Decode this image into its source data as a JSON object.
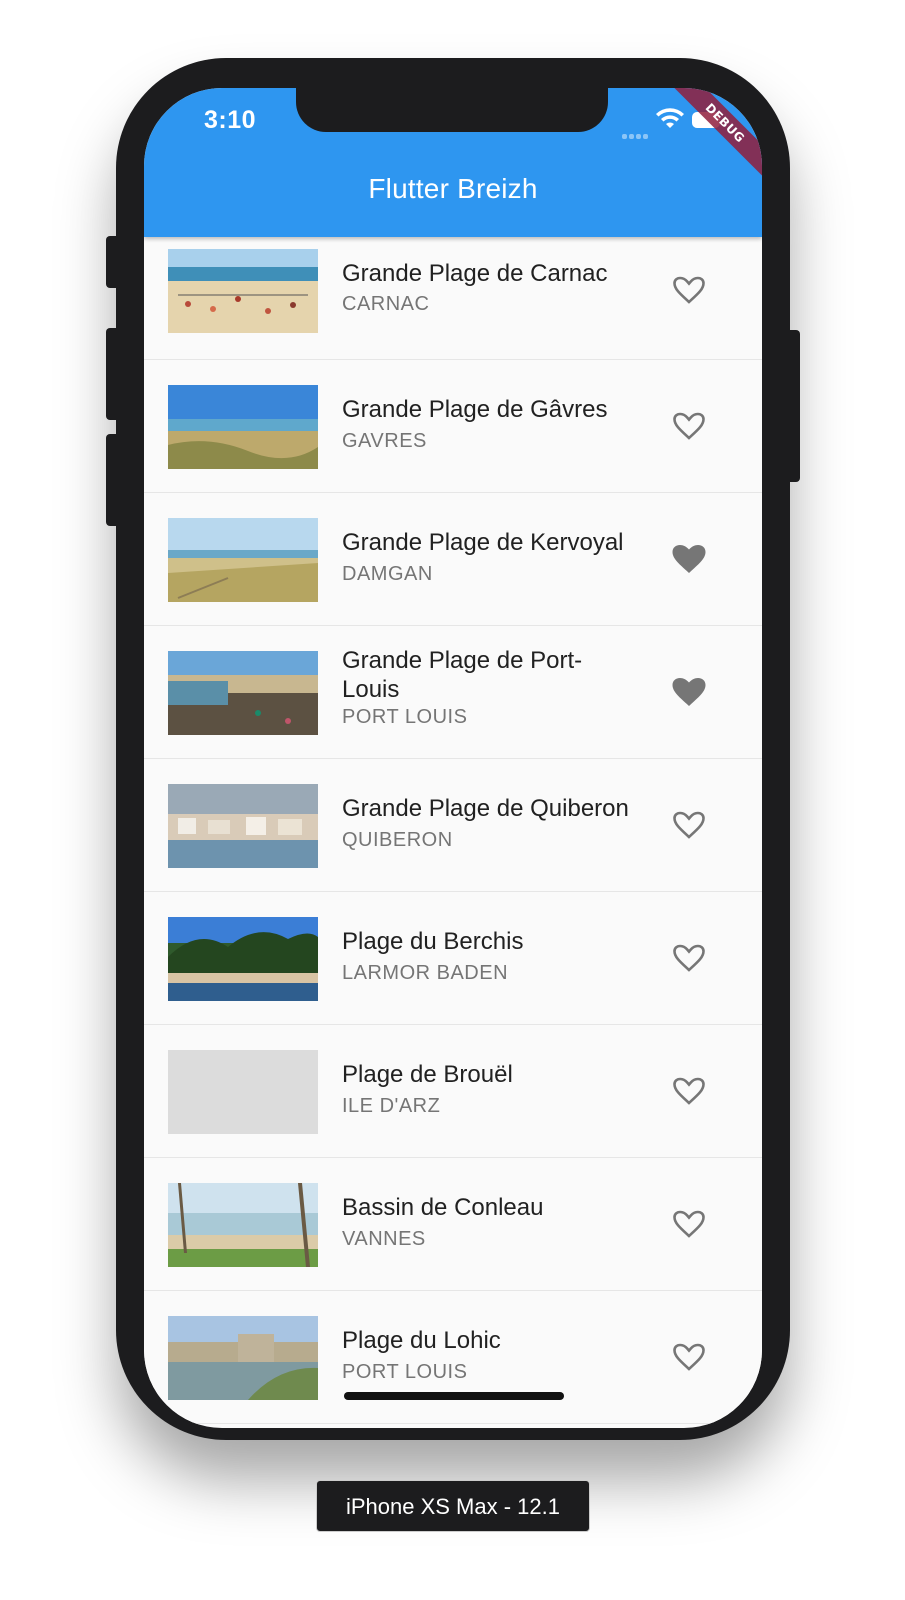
{
  "status_bar": {
    "time": "3:10",
    "debug_label": "DEBUG"
  },
  "app_bar": {
    "title": "Flutter Breizh",
    "color": "#2e96f0"
  },
  "beaches": [
    {
      "name": "Grande Plage de Carnac",
      "town": "CARNAC",
      "favorite": false,
      "thumbnail": "beach-volleyball-photo"
    },
    {
      "name": "Grande Plage de Gâvres",
      "town": "GAVRES",
      "favorite": false,
      "thumbnail": "dunes-sea-photo"
    },
    {
      "name": "Grande Plage de Kervoyal",
      "town": "DAMGAN",
      "favorite": true,
      "thumbnail": "dune-grass-photo"
    },
    {
      "name": "Grande Plage de Port-Louis",
      "town": "PORT LOUIS",
      "favorite": true,
      "thumbnail": "rocky-shore-photo"
    },
    {
      "name": "Grande Plage de Quiberon",
      "town": "QUIBERON",
      "favorite": false,
      "thumbnail": "seafront-town-photo"
    },
    {
      "name": "Plage du Berchis",
      "town": "LARMOR BADEN",
      "favorite": false,
      "thumbnail": "pine-beach-photo"
    },
    {
      "name": "Plage de Brouël",
      "town": "ILE D'ARZ",
      "favorite": false,
      "thumbnail": "placeholder-image"
    },
    {
      "name": "Bassin de Conleau",
      "town": "VANNES",
      "favorite": false,
      "thumbnail": "pool-trees-photo"
    },
    {
      "name": "Plage du Lohic",
      "town": "PORT LOUIS",
      "favorite": false,
      "thumbnail": "fort-shore-photo"
    }
  ],
  "icons": {
    "favorite_on": "heart-filled-icon",
    "favorite_off": "heart-outline-icon"
  },
  "device_label": "iPhone XS Max - 12.1"
}
